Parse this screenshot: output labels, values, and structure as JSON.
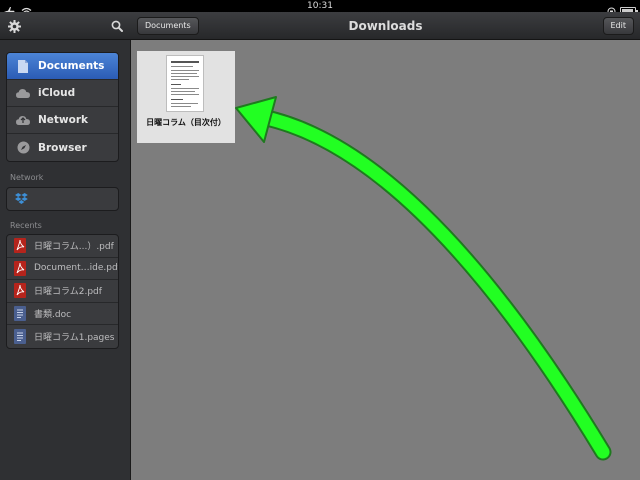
{
  "status_bar": {
    "time": "10:31"
  },
  "sidebar": {
    "nav_items": [
      {
        "label": "Documents",
        "icon": "document-icon",
        "active": true
      },
      {
        "label": "iCloud",
        "icon": "cloud-icon",
        "active": false
      },
      {
        "label": "Network",
        "icon": "network-icon",
        "active": false
      },
      {
        "label": "Browser",
        "icon": "compass-icon",
        "active": false
      }
    ],
    "network_label": "Network",
    "network_service_icon": "dropbox-icon",
    "recents_label": "Recents",
    "recents": [
      {
        "name": "日曜コラム...）.pdf",
        "icon": "pdf-icon"
      },
      {
        "name": "Document…ide.pdf",
        "icon": "pdf-icon"
      },
      {
        "name": "日曜コラム2.pdf",
        "icon": "pdf-icon"
      },
      {
        "name": "書類.doc",
        "icon": "doc-icon"
      },
      {
        "name": "日曜コラム1.pages",
        "icon": "doc-icon"
      }
    ]
  },
  "main": {
    "back_button": "Documents",
    "title": "Downloads",
    "edit_button": "Edit",
    "files": [
      {
        "name": "日曜コラム（目次付）"
      }
    ]
  },
  "colors": {
    "accent": "#2b5cb5",
    "annotation_arrow": "#22ff22",
    "sidebar_bg": "#2f3033",
    "content_bg": "#7d7d7d"
  }
}
